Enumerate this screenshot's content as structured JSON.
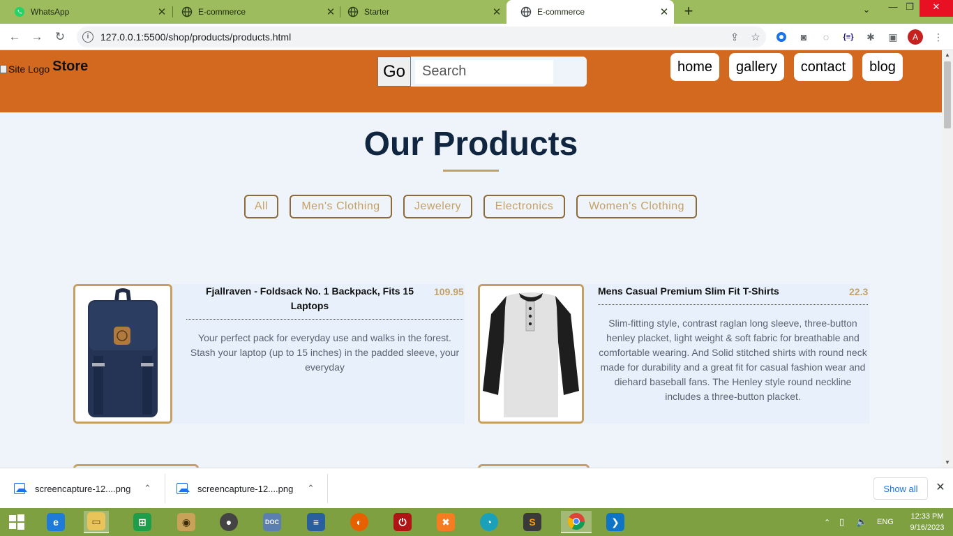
{
  "browser": {
    "tabs": [
      {
        "title": "WhatsApp",
        "icon": "whatsapp-icon",
        "active": false
      },
      {
        "title": "E-commerce",
        "icon": "globe-icon",
        "active": false
      },
      {
        "title": "Starter",
        "icon": "globe-icon",
        "active": false
      },
      {
        "title": "E-commerce",
        "icon": "globe-icon",
        "active": true
      }
    ],
    "url": "127.0.0.1:5500/shop/products/products.html",
    "profile_initial": "A"
  },
  "site": {
    "logo_alt": "Site Logo",
    "brand": "Store",
    "search": {
      "button_label": "Go",
      "placeholder": "Search"
    },
    "nav": [
      "home",
      "gallery",
      "contact",
      "blog"
    ],
    "colors": {
      "header": "#d2691e",
      "accent": "#c4a064",
      "title": "#10253f"
    }
  },
  "main": {
    "title": "Our Products",
    "filters": [
      "All",
      "Men's Clothing",
      "Jewelery",
      "Electronics",
      "Women's Clothing"
    ],
    "products": [
      {
        "name": "Fjallraven - Foldsack No. 1 Backpack, Fits 15 Laptops",
        "price": "109.95",
        "description": "Your perfect pack for everyday use and walks in the forest. Stash your laptop (up to 15 inches) in the padded sleeve, your everyday"
      },
      {
        "name": "Mens Casual Premium Slim Fit T-Shirts",
        "price": "22.3",
        "description": "Slim-fitting style, contrast raglan long sleeve, three-button henley placket, light weight & soft fabric for breathable and comfortable wearing. And Solid stitched shirts with round neck made for durability and a great fit for casual fashion wear and diehard baseball fans. The Henley style round neckline includes a three-button placket."
      }
    ]
  },
  "downloads": {
    "items": [
      "screencapture-12....png",
      "screencapture-12....png"
    ],
    "show_all": "Show all"
  },
  "taskbar": {
    "language": "ENG",
    "time": "12:33 PM",
    "date": "9/16/2023"
  }
}
